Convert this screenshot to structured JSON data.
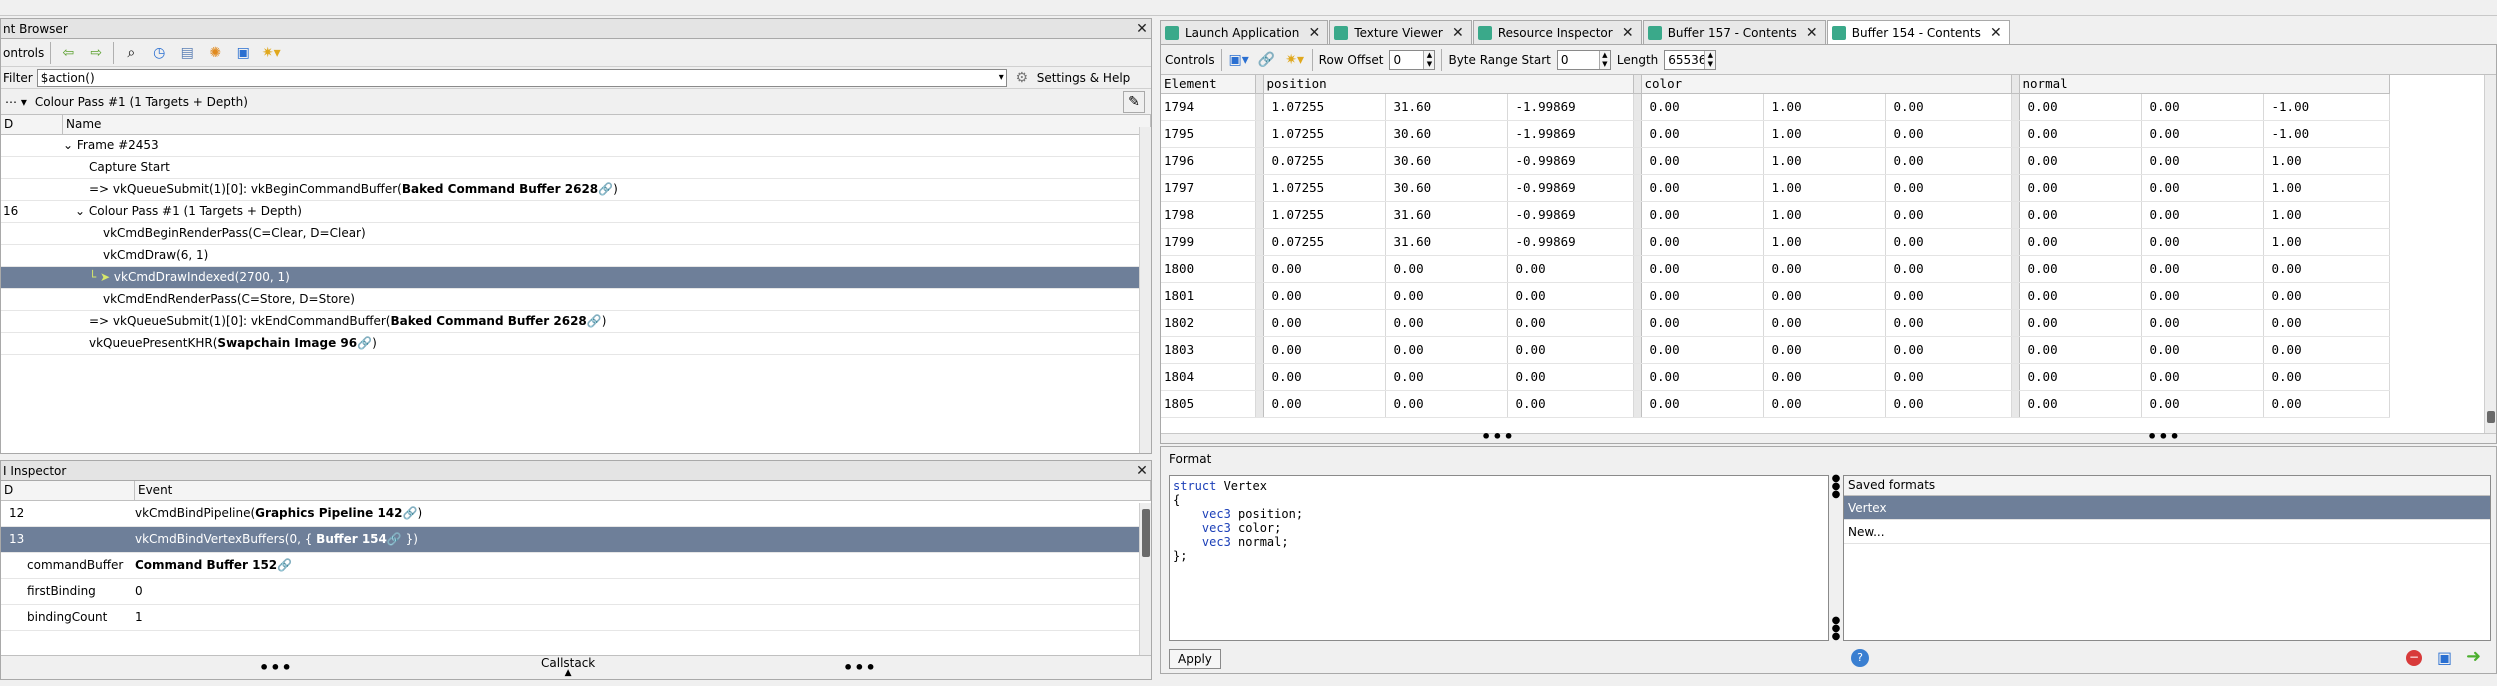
{
  "event_browser": {
    "title": "nt Browser",
    "controls_label": "ontrols",
    "filter_label": "Filter",
    "filter_value": "$action()",
    "settings_label": "Settings & Help",
    "pass_label": "Colour Pass #1 (1 Targets + Depth)",
    "col_eid": "D",
    "col_name": "Name",
    "rows": [
      {
        "eid": "",
        "pre": "Frame #2453",
        "bold": "",
        "post": ""
      },
      {
        "eid": "",
        "pre": "Capture Start",
        "bold": "",
        "post": ""
      },
      {
        "eid": "",
        "pre": "=> vkQueueSubmit(1)[0]: vkBeginCommandBuffer(",
        "bold": "Baked Command Buffer 2628",
        "post": ")"
      },
      {
        "eid": "16",
        "pre": "Colour Pass #1 (1 Targets + Depth)",
        "bold": "",
        "post": ""
      },
      {
        "eid": "",
        "pre": "vkCmdBeginRenderPass(C=Clear, D=Clear)",
        "bold": "",
        "post": ""
      },
      {
        "eid": "",
        "pre": "vkCmdDraw(6, 1)",
        "bold": "",
        "post": ""
      },
      {
        "eid": "",
        "pre": "vkCmdDrawIndexed(2700, 1)",
        "bold": "",
        "post": ""
      },
      {
        "eid": "",
        "pre": "vkCmdEndRenderPass(C=Store, D=Store)",
        "bold": "",
        "post": ""
      },
      {
        "eid": "",
        "pre": "=> vkQueueSubmit(1)[0]: vkEndCommandBuffer(",
        "bold": "Baked Command Buffer 2628",
        "post": ")"
      },
      {
        "eid": "",
        "pre": "vkQueuePresentKHR(",
        "bold": "Swapchain Image 96",
        "post": ")"
      }
    ]
  },
  "api_inspector": {
    "title": "I Inspector",
    "col_eid": "D",
    "col_event": "Event",
    "rows": [
      {
        "eid": "12",
        "pre": "vkCmdBindPipeline(",
        "bold": "Graphics Pipeline 142",
        "post": ")"
      },
      {
        "eid": "13",
        "pre": "vkCmdBindVertexBuffers(0, { ",
        "bold": "Buffer 154",
        "post": " })"
      },
      {
        "eid": "commandBuffer",
        "pre": "",
        "bold": "Command Buffer 152",
        "post": ""
      },
      {
        "eid": "firstBinding",
        "pre": "0",
        "bold": "",
        "post": ""
      },
      {
        "eid": "bindingCount",
        "pre": "1",
        "bold": "",
        "post": ""
      }
    ],
    "callstack_label": "Callstack"
  },
  "tabs": [
    {
      "label": "Launch Application"
    },
    {
      "label": "Texture Viewer"
    },
    {
      "label": "Resource Inspector"
    },
    {
      "label": "Buffer 157 - Contents"
    },
    {
      "label": "Buffer 154 - Contents"
    }
  ],
  "buffer": {
    "controls_label": "Controls",
    "row_offset_label": "Row Offset",
    "row_offset_value": "0",
    "byte_range_label": "Byte Range Start",
    "byte_range_value": "0",
    "length_label": "Length",
    "length_value": "65536",
    "headers": {
      "element": "Element",
      "position": "position",
      "color": "color",
      "normal": "normal"
    },
    "rows": [
      [
        "1794",
        "1.07255",
        "31.60",
        "-1.99869",
        "0.00",
        "1.00",
        "0.00",
        "0.00",
        "0.00",
        "-1.00"
      ],
      [
        "1795",
        "1.07255",
        "30.60",
        "-1.99869",
        "0.00",
        "1.00",
        "0.00",
        "0.00",
        "0.00",
        "-1.00"
      ],
      [
        "1796",
        "0.07255",
        "30.60",
        "-0.99869",
        "0.00",
        "1.00",
        "0.00",
        "0.00",
        "0.00",
        "1.00"
      ],
      [
        "1797",
        "1.07255",
        "30.60",
        "-0.99869",
        "0.00",
        "1.00",
        "0.00",
        "0.00",
        "0.00",
        "1.00"
      ],
      [
        "1798",
        "1.07255",
        "31.60",
        "-0.99869",
        "0.00",
        "1.00",
        "0.00",
        "0.00",
        "0.00",
        "1.00"
      ],
      [
        "1799",
        "0.07255",
        "31.60",
        "-0.99869",
        "0.00",
        "1.00",
        "0.00",
        "0.00",
        "0.00",
        "1.00"
      ],
      [
        "1800",
        "0.00",
        "0.00",
        "0.00",
        "0.00",
        "0.00",
        "0.00",
        "0.00",
        "0.00",
        "0.00"
      ],
      [
        "1801",
        "0.00",
        "0.00",
        "0.00",
        "0.00",
        "0.00",
        "0.00",
        "0.00",
        "0.00",
        "0.00"
      ],
      [
        "1802",
        "0.00",
        "0.00",
        "0.00",
        "0.00",
        "0.00",
        "0.00",
        "0.00",
        "0.00",
        "0.00"
      ],
      [
        "1803",
        "0.00",
        "0.00",
        "0.00",
        "0.00",
        "0.00",
        "0.00",
        "0.00",
        "0.00",
        "0.00"
      ],
      [
        "1804",
        "0.00",
        "0.00",
        "0.00",
        "0.00",
        "0.00",
        "0.00",
        "0.00",
        "0.00",
        "0.00"
      ],
      [
        "1805",
        "0.00",
        "0.00",
        "0.00",
        "0.00",
        "0.00",
        "0.00",
        "0.00",
        "0.00",
        "0.00"
      ]
    ]
  },
  "format": {
    "title": "Format",
    "code_keyword": "struct",
    "code_struct_name": " Vertex",
    "code_lines": [
      {
        "type": "vec3",
        "name": " position;"
      },
      {
        "type": "vec3",
        "name": " color;"
      },
      {
        "type": "vec3",
        "name": " normal;"
      }
    ],
    "saved_header": "Saved formats",
    "saved_items": [
      "Vertex",
      "New..."
    ],
    "apply_label": "Apply"
  },
  "colors": {
    "selection": "#6e7f99",
    "tab_icon": "#3aa98a",
    "code_keyword": "#1b3fb8"
  }
}
